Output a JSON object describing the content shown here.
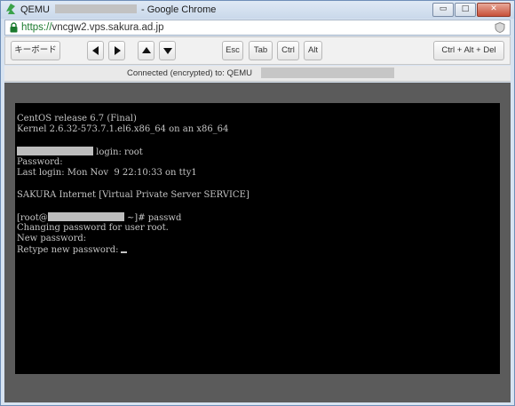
{
  "window": {
    "title_prefix": "QEMU",
    "title_suffix": "- Google Chrome",
    "minimize_label": "▭",
    "maximize_label": "□",
    "close_label": "✕"
  },
  "urlbar": {
    "scheme": "https://",
    "host": "vncgw2.vps.sakura.ad.jp"
  },
  "toolbar": {
    "keyboard_label": "キーボード",
    "esc_label": "Esc",
    "tab_label": "Tab",
    "ctrl_label": "Ctrl",
    "alt_label": "Alt",
    "cad_label": "Ctrl + Alt + Del"
  },
  "status": {
    "text": "Connected (encrypted) to: QEMU"
  },
  "terminal": {
    "line1": "CentOS release 6.7 (Final)",
    "line2": "Kernel 2.6.32-573.7.1.el6.x86_64 on an x86_64",
    "line3_suffix": " login: root",
    "line4": "Password:",
    "line5": "Last login: Mon Nov  9 22:10:33 on tty1",
    "line6": "SAKURA Internet [Virtual Private Server SERVICE]",
    "prompt_prefix": "[root@",
    "prompt_suffix": " ~]# passwd",
    "line8": "Changing password for user root.",
    "line9": "New password:",
    "line10": "Retype new password:"
  },
  "colors": {
    "terminal_bg": "#000000",
    "terminal_fg": "#c4c4c4",
    "viewport_bg": "#5b5b5b",
    "url_secure": "#1b7a2e"
  }
}
